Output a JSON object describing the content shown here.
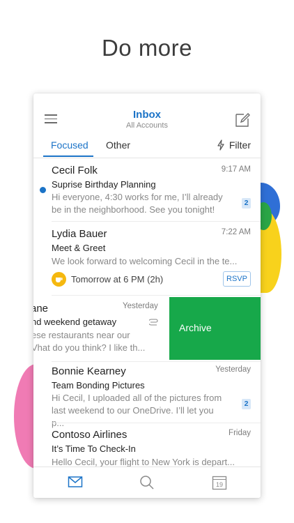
{
  "headline": "Do more",
  "header": {
    "title": "Inbox",
    "subtitle": "All Accounts"
  },
  "tabs": {
    "focused": "Focused",
    "other": "Other",
    "filter": "Filter"
  },
  "messages": [
    {
      "sender": "Cecil Folk",
      "time": "9:17 AM",
      "subject": "Suprise Birthday Planning",
      "preview_line1": "Hi everyone, 4:30 works for me, I’ll already",
      "preview_line2": "be in the neighborhood. See you tonight!",
      "count": "2",
      "unread": true
    },
    {
      "sender": "Lydia Bauer",
      "time": "7:22 AM",
      "subject": "Meet & Greet",
      "preview_line1": "We look forward to welcoming Cecil in the te...",
      "event": "Tomorrow at 6 PM (2h)",
      "rsvp": "RSVP"
    },
    {
      "sender": "ane",
      "time": "Yesterday",
      "subject": "nd weekend getaway",
      "preview_line1": "ese restaurants near our",
      "preview_line2": "Vhat do you think? I like th...",
      "swipe_action": "Archive"
    },
    {
      "sender": "Bonnie Kearney",
      "time": "Yesterday",
      "subject": "Team Bonding Pictures",
      "preview_line1": "Hi Cecil, I uploaded all of the pictures from",
      "preview_line2": "last weekend to our OneDrive. I’ll let you p...",
      "count": "2"
    },
    {
      "sender": "Contoso Airlines",
      "time": "Friday",
      "subject": "It’s Time To Check-In",
      "preview_line1": "Hello Cecil, your flight to New York is depart..."
    }
  ],
  "bottom_nav": {
    "calendar_day": "19"
  },
  "colors": {
    "accent": "#1b73c7",
    "archive": "#17a84a"
  },
  "icons": [
    "hamburger-icon",
    "compose-icon",
    "filter-icon",
    "attachment-icon",
    "coffee-icon",
    "mail-icon",
    "search-icon",
    "calendar-icon"
  ]
}
